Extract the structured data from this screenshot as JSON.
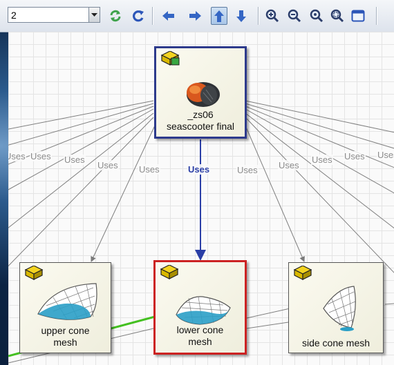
{
  "toolbar": {
    "combo_value": "2",
    "buttons": [
      "combo-dropdown",
      "refresh",
      "reload",
      "back",
      "forward",
      "up",
      "down",
      "zoom-in",
      "zoom-out",
      "zoom-fit",
      "zoom-selection",
      "window"
    ]
  },
  "graph": {
    "edge_label": "Uses",
    "nodes": {
      "seascooter": {
        "label_line1": "_zs06",
        "label_line2": "seascooter final"
      },
      "upper": {
        "label_line1": "upper cone",
        "label_line2": "mesh"
      },
      "lower": {
        "label_line1": "lower cone",
        "label_line2": "mesh"
      },
      "side": {
        "label_line1": "side cone mesh",
        "label_line2": ""
      }
    }
  },
  "colors": {
    "selected_edge": "#2a3ea6",
    "top_node_border": "#2d3a8c",
    "selected_node_border": "#cc2222",
    "green_edge": "#44c021"
  }
}
